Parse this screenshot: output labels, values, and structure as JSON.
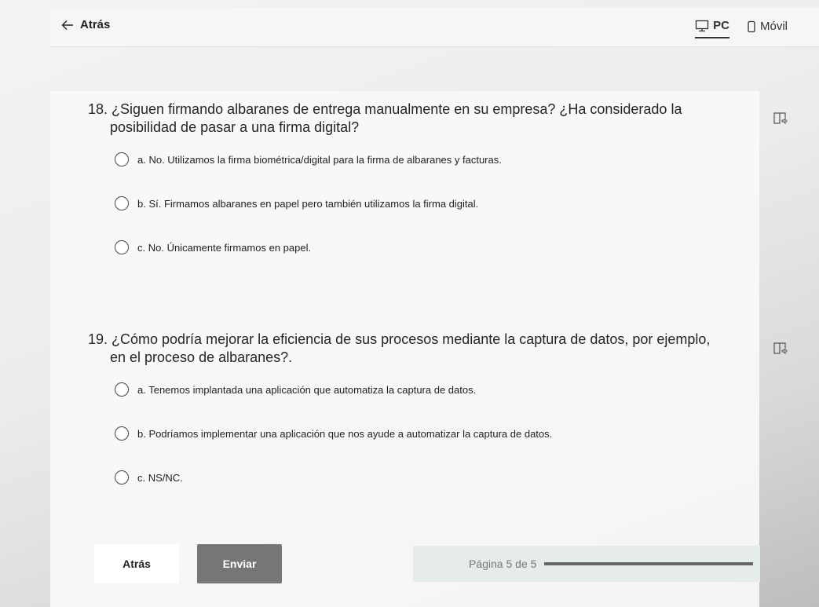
{
  "header": {
    "back_label": "Atrás",
    "device_tabs": [
      {
        "label": "PC",
        "icon": "desktop-icon",
        "active": true
      },
      {
        "label": "Móvil",
        "icon": "mobile-icon",
        "active": false
      }
    ]
  },
  "questions": [
    {
      "title": "18. ¿Siguen firmando albaranes de entrega manualmente en su empresa? ¿Ha considerado la posibilidad de pasar a una firma digital?",
      "options": [
        "a. No. Utilizamos la firma biométrica/digital para la firma de albaranes y facturas.",
        "b. Sí. Firmamos albaranes en papel pero también utilizamos la firma digital.",
        "c. No. Únicamente firmamos en papel."
      ]
    },
    {
      "title": "19. ¿Cómo podría mejorar la eficiencia de sus procesos mediante la captura de datos, por ejemplo, en el proceso de albaranes?.",
      "options": [
        "a. Tenemos implantada una aplicación que automatiza la captura de datos.",
        "b. Podríamos implementar una aplicación que nos ayude a automatizar la captura de datos.",
        "c. NS/NC."
      ]
    }
  ],
  "footer": {
    "back_label": "Atrás",
    "submit_label": "Enviar",
    "page_label": "Página 5 de 5",
    "progress": 1.0
  },
  "colors": {
    "submit_bg": "#767676",
    "progress_fill": "#666666",
    "progress_box": "#e6ebeb"
  }
}
